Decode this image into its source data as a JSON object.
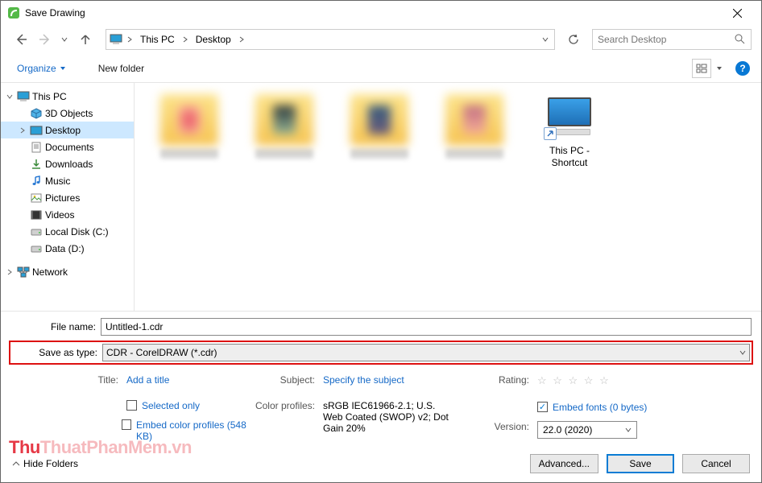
{
  "window": {
    "title": "Save Drawing"
  },
  "nav": {
    "breadcrumb": [
      "This PC",
      "Desktop"
    ],
    "search_placeholder": "Search Desktop"
  },
  "toolbar": {
    "organize": "Organize",
    "new_folder": "New folder"
  },
  "tree": {
    "items": [
      {
        "label": "This PC",
        "icon": "pc",
        "twisty": "down",
        "indent": 0,
        "selected": false
      },
      {
        "label": "3D Objects",
        "icon": "3d",
        "twisty": "",
        "indent": 1,
        "selected": false
      },
      {
        "label": "Desktop",
        "icon": "desktop",
        "twisty": "right",
        "indent": 1,
        "selected": true
      },
      {
        "label": "Documents",
        "icon": "doc",
        "twisty": "",
        "indent": 1,
        "selected": false
      },
      {
        "label": "Downloads",
        "icon": "download",
        "twisty": "",
        "indent": 1,
        "selected": false
      },
      {
        "label": "Music",
        "icon": "music",
        "twisty": "",
        "indent": 1,
        "selected": false
      },
      {
        "label": "Pictures",
        "icon": "pic",
        "twisty": "",
        "indent": 1,
        "selected": false
      },
      {
        "label": "Videos",
        "icon": "video",
        "twisty": "",
        "indent": 1,
        "selected": false
      },
      {
        "label": "Local Disk (C:)",
        "icon": "disk",
        "twisty": "",
        "indent": 1,
        "selected": false
      },
      {
        "label": "Data (D:)",
        "icon": "disk",
        "twisty": "",
        "indent": 1,
        "selected": false
      }
    ],
    "network": {
      "label": "Network",
      "twisty": "right"
    }
  },
  "content": {
    "shortcut_label": "This PC - Shortcut"
  },
  "fields": {
    "filename_label": "File name:",
    "filename_value": "Untitled-1.cdr",
    "savetype_label": "Save as type:",
    "savetype_value": "CDR - CorelDRAW (*.cdr)"
  },
  "meta": {
    "title_label": "Title:",
    "title_placeholder": "Add a title",
    "subject_label": "Subject:",
    "subject_placeholder": "Specify the subject",
    "rating_label": "Rating:",
    "selected_only": "Selected only",
    "embed_profiles": "Embed color profiles (548 KB)",
    "color_profiles_label": "Color profiles:",
    "color_profiles_value": "sRGB IEC61966-2.1; U.S. Web Coated (SWOP) v2; Dot Gain 20%",
    "embed_fonts": "Embed fonts (0 bytes)",
    "embed_fonts_checked": true,
    "version_label": "Version:",
    "version_value": "22.0 (2020)"
  },
  "footer": {
    "hide_folders": "Hide Folders",
    "advanced": "Advanced...",
    "save": "Save",
    "cancel": "Cancel"
  },
  "watermark": {
    "a": "Thu",
    "b": "ThuatPhanMem",
    "c": ".vn"
  }
}
